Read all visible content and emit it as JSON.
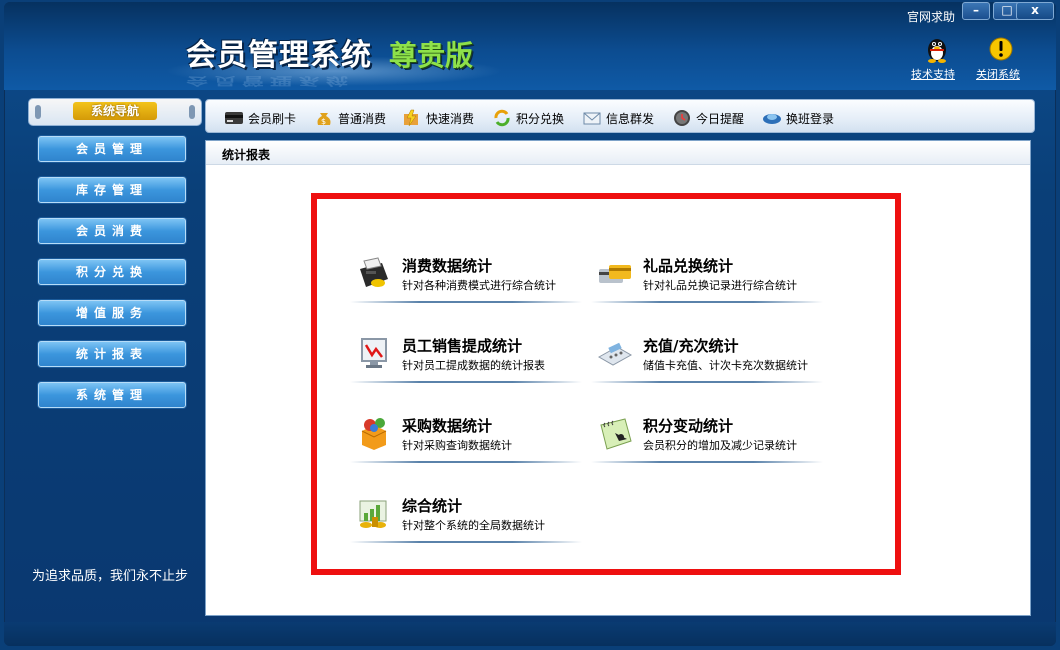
{
  "app": {
    "title": "会员管理系统",
    "edition": "尊贵版"
  },
  "window": {
    "help_label": "官网求助",
    "minimize": "–",
    "maximize": "□",
    "close": "x"
  },
  "top_actions": {
    "support_label": "技术支持",
    "support_icon": "penguin-icon",
    "close_system_label": "关闭系统",
    "close_system_icon": "warning-icon"
  },
  "sidebar": {
    "header": "系统导航",
    "items": [
      {
        "label": "会员管理"
      },
      {
        "label": "库存管理"
      },
      {
        "label": "会员消费"
      },
      {
        "label": "积分兑换"
      },
      {
        "label": "增值服务"
      },
      {
        "label": "统计报表"
      },
      {
        "label": "系统管理"
      }
    ],
    "slogan": "为追求品质，我们永不止步"
  },
  "toolbar": {
    "items": [
      {
        "label": "会员刷卡",
        "icon": "card-reader-icon"
      },
      {
        "label": "普通消费",
        "icon": "money-bag-icon"
      },
      {
        "label": "快速消费",
        "icon": "lightning-icon"
      },
      {
        "label": "积分兑换",
        "icon": "exchange-icon"
      },
      {
        "label": "信息群发",
        "icon": "envelope-icon"
      },
      {
        "label": "今日提醒",
        "icon": "clock-icon"
      },
      {
        "label": "换班登录",
        "icon": "login-icon"
      }
    ]
  },
  "content": {
    "section_title": "统计报表",
    "reports": [
      {
        "title": "消费数据统计",
        "subtitle": "针对各种消费模式进行综合统计",
        "icon": "cash-register-icon"
      },
      {
        "title": "礼品兑换统计",
        "subtitle": "针对礼品兑换记录进行综合统计",
        "icon": "cards-icon"
      },
      {
        "title": "员工销售提成统计",
        "subtitle": "针对员工提成数据的统计报表",
        "icon": "monitor-chart-icon"
      },
      {
        "title": "充值/充次统计",
        "subtitle": "储值卡充值、计次卡充次数据统计",
        "icon": "calculator-icon"
      },
      {
        "title": "采购数据统计",
        "subtitle": "针对采购查询数据统计",
        "icon": "purchase-box-icon"
      },
      {
        "title": "积分变动统计",
        "subtitle": "会员积分的增加及减少记录统计",
        "icon": "notebook-icon"
      },
      {
        "title": "综合统计",
        "subtitle": "针对整个系统的全局数据统计",
        "icon": "bar-chart-coins-icon"
      }
    ]
  },
  "colors": {
    "highlight_border": "#ee1010",
    "edition_green": "#8ee14a",
    "nav_blue": "#3c96dd"
  }
}
